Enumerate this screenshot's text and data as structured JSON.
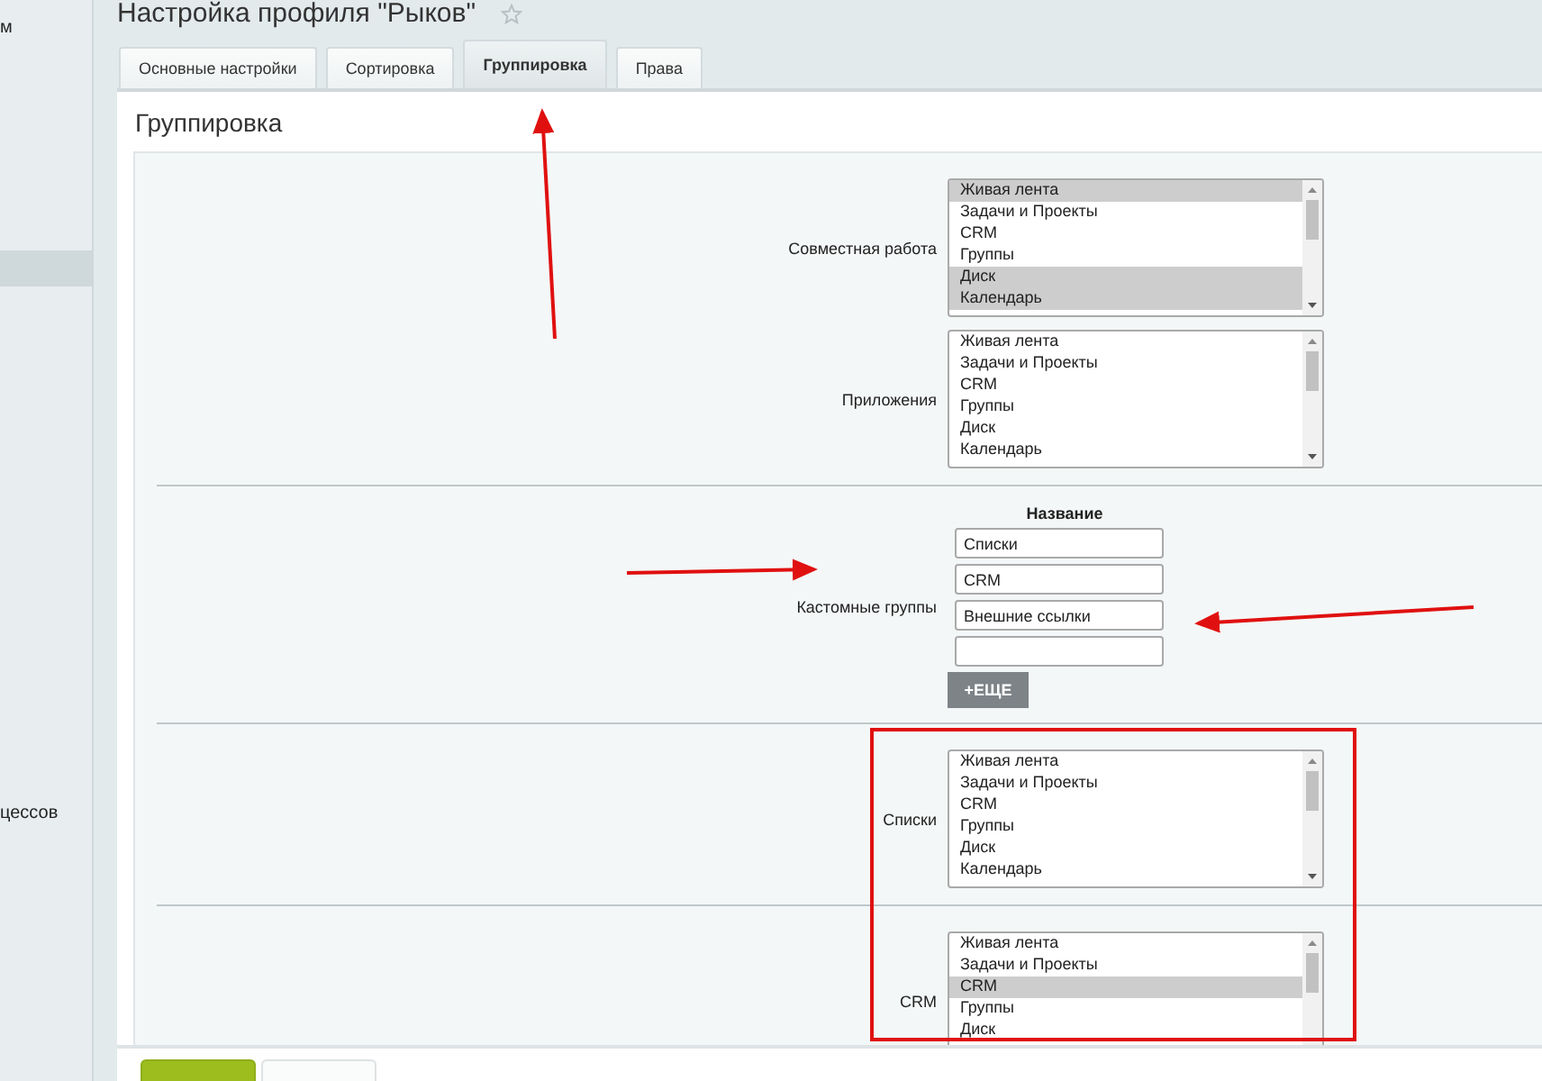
{
  "sidebar": {
    "items": [
      {
        "label": "м",
        "selected": false
      },
      {
        "selected": true
      },
      {
        "label": "цессов",
        "selected": false
      }
    ]
  },
  "page_title": "Настройка профиля \"Рыков\"",
  "tabs": [
    {
      "label": "Основные настройки",
      "selected": false
    },
    {
      "label": "Сортировка",
      "selected": false
    },
    {
      "label": "Группировка",
      "selected": true
    },
    {
      "label": "Права",
      "selected": false
    }
  ],
  "section_title": "Группировка",
  "groups": [
    {
      "rows": [
        {
          "kind": "listbox",
          "label": "Совместная работа",
          "options": [
            {
              "label": "Живая лента",
              "selected": true
            },
            {
              "label": "Задачи и Проекты",
              "selected": false
            },
            {
              "label": "CRM",
              "selected": false
            },
            {
              "label": "Группы",
              "selected": false
            },
            {
              "label": "Диск",
              "selected": true
            },
            {
              "label": "Календарь",
              "selected": true
            }
          ]
        },
        {
          "kind": "listbox",
          "label": "Приложения",
          "options": [
            {
              "label": "Живая лента",
              "selected": false
            },
            {
              "label": "Задачи и Проекты",
              "selected": false
            },
            {
              "label": "CRM",
              "selected": false
            },
            {
              "label": "Группы",
              "selected": false
            },
            {
              "label": "Диск",
              "selected": false
            },
            {
              "label": "Календарь",
              "selected": false
            }
          ]
        }
      ]
    },
    {
      "rows": [
        {
          "kind": "inputs",
          "label": "Кастомные группы",
          "header": "Название",
          "values": [
            "Списки",
            "CRM",
            "Внешние ссылки"
          ],
          "blank_field": true,
          "add_button": "+ЕЩЕ"
        }
      ]
    },
    {
      "rows": [
        {
          "kind": "listbox",
          "label": "Списки",
          "options": [
            {
              "label": "Живая лента",
              "selected": false
            },
            {
              "label": "Задачи и Проекты",
              "selected": false
            },
            {
              "label": "CRM",
              "selected": false
            },
            {
              "label": "Группы",
              "selected": false
            },
            {
              "label": "Диск",
              "selected": false
            },
            {
              "label": "Календарь",
              "selected": false
            }
          ]
        }
      ]
    },
    {
      "rows": [
        {
          "kind": "listbox",
          "label": "CRM",
          "options": [
            {
              "label": "Живая лента",
              "selected": false
            },
            {
              "label": "Задачи и Проекты",
              "selected": false
            },
            {
              "label": "CRM",
              "selected": true
            },
            {
              "label": "Группы",
              "selected": false
            },
            {
              "label": "Диск",
              "selected": false
            }
          ]
        }
      ]
    }
  ],
  "footer_buttons": [
    {
      "kind": "primary"
    },
    {
      "kind": "secondary"
    }
  ]
}
